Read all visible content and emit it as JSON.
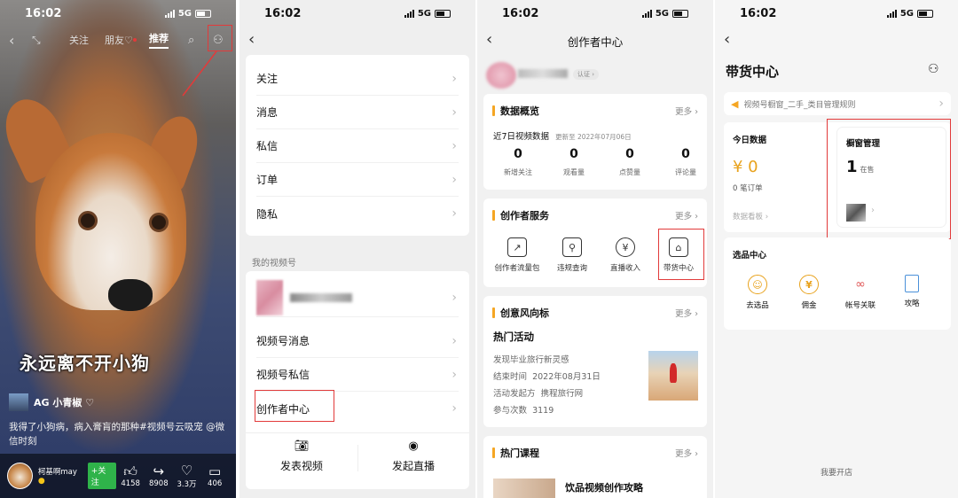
{
  "panel1": {
    "status": {
      "time": "16:02",
      "network": "5G"
    },
    "nav": {
      "follow": "关注",
      "friends": "朋友♡",
      "recommend": "推荐"
    },
    "caption": "永远离不开小狗",
    "author": "AG 小青椒 ♡",
    "description": "我得了小狗病，病入膏肓的那种#视频号云吸宠 @微信时刻",
    "bottom": {
      "username": "柯基啊may",
      "follow_label": "+关注",
      "likes": "4158",
      "shares": "8908",
      "hearts": "3.3万",
      "comments": "406"
    }
  },
  "panel2": {
    "status": {
      "time": "16:02",
      "network": "5G"
    },
    "menu": [
      "关注",
      "消息",
      "私信",
      "订单",
      "隐私"
    ],
    "section_label": "我的视频号",
    "channel_items": [
      "视频号消息",
      "视频号私信",
      "创作者中心"
    ],
    "actions": {
      "post": "发表视频",
      "live": "发起直播"
    }
  },
  "panel3": {
    "status": {
      "time": "16:02",
      "network": "5G"
    },
    "title": "创作者中心",
    "verify_label": "认证 ›",
    "overview": {
      "title": "数据概览",
      "more": "更多",
      "subtitle": "近7日视频数据",
      "updated": "更新至 2022年07月06日",
      "stats": [
        {
          "value": "0",
          "label": "新增关注"
        },
        {
          "value": "0",
          "label": "观看量"
        },
        {
          "value": "0",
          "label": "点赞量"
        },
        {
          "value": "0",
          "label": "评论量"
        }
      ]
    },
    "services": {
      "title": "创作者服务",
      "more": "更多",
      "items": [
        "创作者流量包",
        "违规查询",
        "直播收入",
        "带货中心"
      ]
    },
    "trends": {
      "title": "创意风向标",
      "more": "更多",
      "hot_title": "热门活动",
      "activity": "发现毕业旅行新灵感",
      "end_label": "结束时间",
      "end_date": "2022年08月31日",
      "org_label": "活动发起方",
      "org": "携程旅行网",
      "count_label": "参与次数",
      "count": "3119"
    },
    "courses": {
      "title": "热门课程",
      "more": "更多",
      "first": "饮品视频创作攻略"
    }
  },
  "panel4": {
    "status": {
      "time": "16:02",
      "network": "5G"
    },
    "title": "带货中心",
    "notice": "视频号橱窗_二手_类目管理规则",
    "today": {
      "title": "今日数据",
      "amount": "¥ 0",
      "orders": "0 笔订单",
      "board": "数据看板 ›"
    },
    "window": {
      "title": "橱窗管理",
      "count": "1",
      "count_label": "在售"
    },
    "selection": {
      "title": "选品中心",
      "items": [
        "去选品",
        "佣金",
        "帐号关联",
        "攻略"
      ]
    },
    "open_shop": "我要开店"
  },
  "colors": {
    "accent": "#f5a623",
    "gold": "#e8a21c",
    "annotation": "#e23a3a",
    "follow": "#2fb34a"
  }
}
